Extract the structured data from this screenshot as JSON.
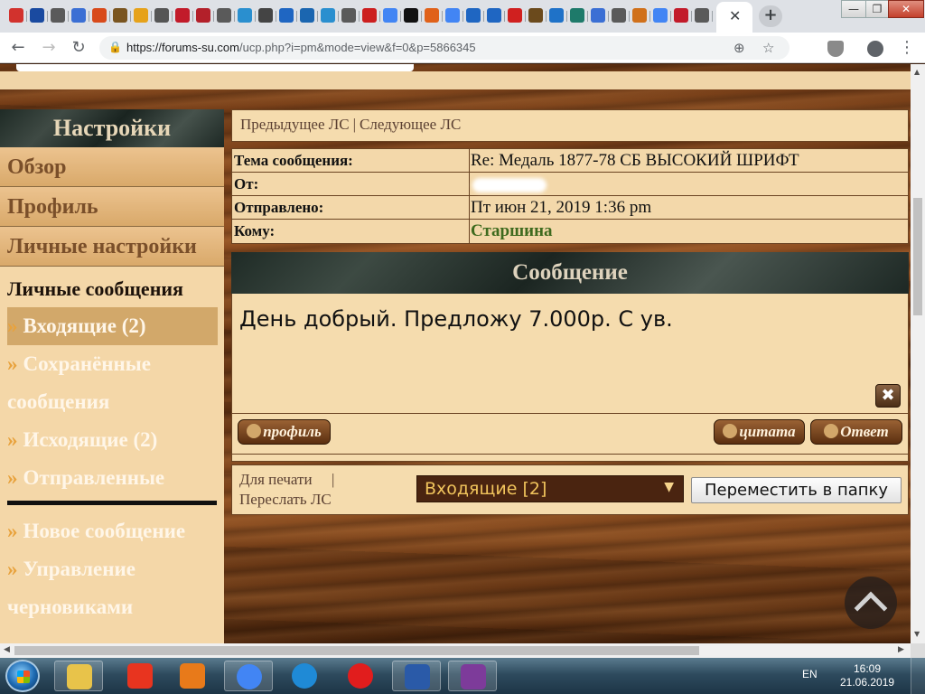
{
  "browser": {
    "tabs": [
      {
        "icon": "red-shield-icon",
        "color": "#d2322d"
      },
      {
        "icon": "blue-square-icon",
        "color": "#1a4aa0"
      },
      {
        "icon": "h-icon",
        "color": "#5a5a5a"
      },
      {
        "icon": "cart-icon",
        "color": "#3b6fd4"
      },
      {
        "icon": "red-logo-icon",
        "color": "#d84a1b"
      },
      {
        "icon": "book-icon",
        "color": "#7a5520"
      },
      {
        "icon": "yellow-y-icon",
        "color": "#e6a21a"
      },
      {
        "icon": "globe-icon",
        "color": "#555555"
      },
      {
        "icon": "red-seal-icon",
        "color": "#c21b2a"
      },
      {
        "icon": "red-eagle-icon",
        "color": "#b3202a"
      },
      {
        "icon": "h-icon",
        "color": "#5a5a5a"
      },
      {
        "icon": "ring-icon",
        "color": "#2a8fcf"
      },
      {
        "icon": "diamond-icon",
        "color": "#444444"
      },
      {
        "icon": "slash-icon",
        "color": "#1f66c2"
      },
      {
        "icon": "blue-oval-icon",
        "color": "#1b66b0"
      },
      {
        "icon": "ring-icon",
        "color": "#2a8fcf"
      },
      {
        "icon": "h-icon",
        "color": "#5a5a5a"
      },
      {
        "icon": "red-fd-icon",
        "color": "#cc1f1f"
      },
      {
        "icon": "google-icon",
        "color": "#4285f4"
      },
      {
        "icon": "black-p-icon",
        "color": "#111111"
      },
      {
        "icon": "orange-badge-icon",
        "color": "#e0611a"
      },
      {
        "icon": "google-icon",
        "color": "#4285f4"
      },
      {
        "icon": "slash-icon",
        "color": "#1f66c2"
      },
      {
        "icon": "slash-icon",
        "color": "#1f66c2"
      },
      {
        "icon": "hh-icon",
        "color": "#d0201f"
      },
      {
        "icon": "book-icon",
        "color": "#6b4a1c"
      },
      {
        "icon": "plus-cross-icon",
        "color": "#1f72c8"
      },
      {
        "icon": "teal-globe-icon",
        "color": "#1e7a6a"
      },
      {
        "icon": "cart-icon",
        "color": "#3b6fd4"
      },
      {
        "icon": "h-icon",
        "color": "#5a5a5a"
      },
      {
        "icon": "striped-icon",
        "color": "#d0701a"
      },
      {
        "icon": "google-icon",
        "color": "#4285f4"
      },
      {
        "icon": "red-seal-icon",
        "color": "#c21b2a"
      },
      {
        "icon": "h-icon",
        "color": "#5a5a5a"
      }
    ],
    "active_tab_close": "✕",
    "new_tab": "+",
    "window_buttons": {
      "minimize": "—",
      "maximize": "❐",
      "close": "✕"
    },
    "url_host": "https://forums-su.com",
    "url_path": "/ucp.php?i=pm&mode=view&f=0&p=5866345"
  },
  "sidebar": {
    "title": "Настройки",
    "links": [
      "Обзор",
      "Профиль",
      "Личные настройки"
    ],
    "active_section": "Личные сообщения",
    "sub_items": [
      {
        "label": "Входящие (2)",
        "selected": true
      },
      {
        "label": "Сохранённые сообщения",
        "selected": false
      },
      {
        "label": "Исходящие (2)",
        "selected": false
      },
      {
        "label": "Отправленные",
        "selected": false
      }
    ],
    "extra_items": [
      "Новое сообщение",
      "Управление черновиками"
    ],
    "bullet": "»"
  },
  "pm_nav": {
    "prev": "Предыдущее ЛС",
    "sep": "|",
    "next": "Следующее ЛС"
  },
  "header": {
    "subject_label": "Тема сообщения:",
    "subject_value": "Re: Медаль 1877-78 СБ ВЫСОКИЙ ШРИФТ",
    "from_label": "От:",
    "sent_label": "Отправлено:",
    "sent_value": "Пт июн 21, 2019 1:36 pm",
    "to_label": "Кому:",
    "to_value": "Старшина"
  },
  "message": {
    "heading": "Сообщение",
    "text": "День добрый. Предложу 7.000р. С ув.",
    "report_icon": "✖"
  },
  "actions": {
    "profile": "профиль",
    "quote": "цитата",
    "reply": "Ответ"
  },
  "tools": {
    "print": "Для печати",
    "sep": "|",
    "forward": "Переслать ЛС",
    "folder_selected": "Входящие [2]",
    "move_button": "Переместить в папку"
  },
  "taskbar": {
    "apps": [
      {
        "icon": "explorer-icon",
        "color": "#e8c34a",
        "pinned": true
      },
      {
        "icon": "yandex-icon",
        "color": "#e8341f",
        "pinned": false
      },
      {
        "icon": "media-player-icon",
        "color": "#e87a1a",
        "pinned": false
      },
      {
        "icon": "chrome-icon",
        "color": "#4285f4",
        "pinned": true
      },
      {
        "icon": "ie-icon",
        "color": "#1f8ad6",
        "pinned": false
      },
      {
        "icon": "yandex-browser-icon",
        "color": "#e11d1d",
        "pinned": false
      },
      {
        "icon": "word-icon",
        "color": "#2a5aa8",
        "pinned": true
      },
      {
        "icon": "onenote-icon",
        "color": "#7d3b9a",
        "pinned": true
      }
    ],
    "language": "EN",
    "time": "16:09",
    "date": "21.06.2019"
  }
}
